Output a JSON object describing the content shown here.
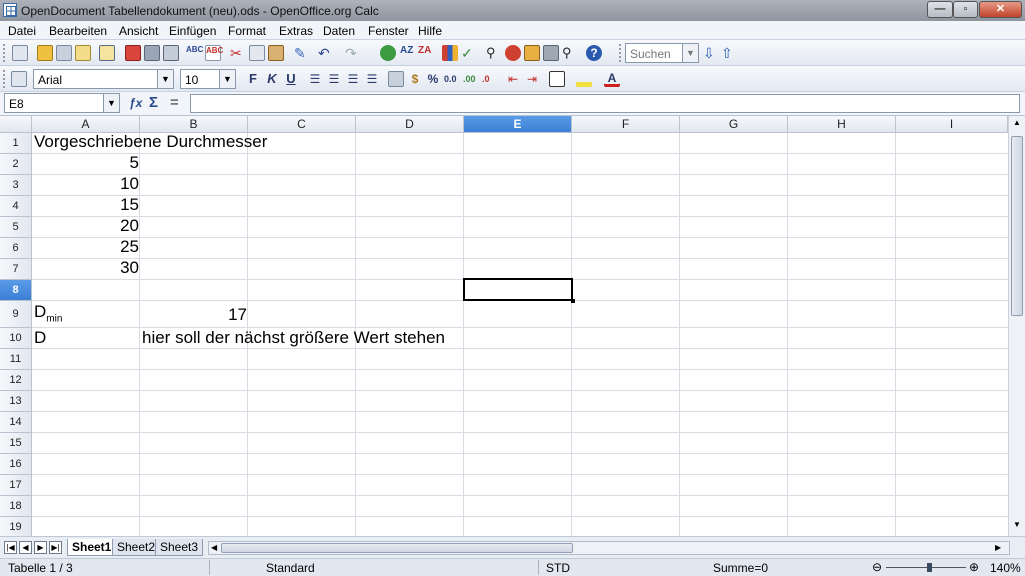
{
  "window": {
    "title": "OpenDocument Tabellendokument (neu).ods - OpenOffice.org Calc"
  },
  "menu": [
    "Datei",
    "Bearbeiten",
    "Ansicht",
    "Einfügen",
    "Format",
    "Extras",
    "Daten",
    "Fenster",
    "Hilfe"
  ],
  "toolbar": {
    "search_placeholder": "Suchen"
  },
  "format": {
    "font_name": "Arial",
    "font_size": "10"
  },
  "formula_bar": {
    "name_box": "E8",
    "input": ""
  },
  "columns": [
    "A",
    "B",
    "C",
    "D",
    "E",
    "F",
    "G",
    "H",
    "I"
  ],
  "selected_column": "E",
  "selected_row": "8",
  "rows": [
    "1",
    "2",
    "3",
    "4",
    "5",
    "6",
    "7",
    "8",
    "9",
    "10",
    "11",
    "12",
    "13",
    "14",
    "15",
    "16",
    "17",
    "18",
    "19"
  ],
  "cells": {
    "a1": "Vorgeschriebene Durchmesser",
    "a2": "5",
    "a3": "10",
    "a4": "15",
    "a5": "20",
    "a6": "25",
    "a7": "30",
    "a9_main": "D",
    "a9_sub": "min",
    "b9": "17",
    "a10": "D",
    "b10": "hier soll der nächst größere Wert stehen"
  },
  "sheets": [
    "Sheet1",
    "Sheet2",
    "Sheet3"
  ],
  "active_sheet": "Sheet1",
  "status": {
    "sheet": "Tabelle 1 / 3",
    "style": "Standard",
    "mode": "STD",
    "sum": "Summe=0",
    "zoom": "140%"
  }
}
